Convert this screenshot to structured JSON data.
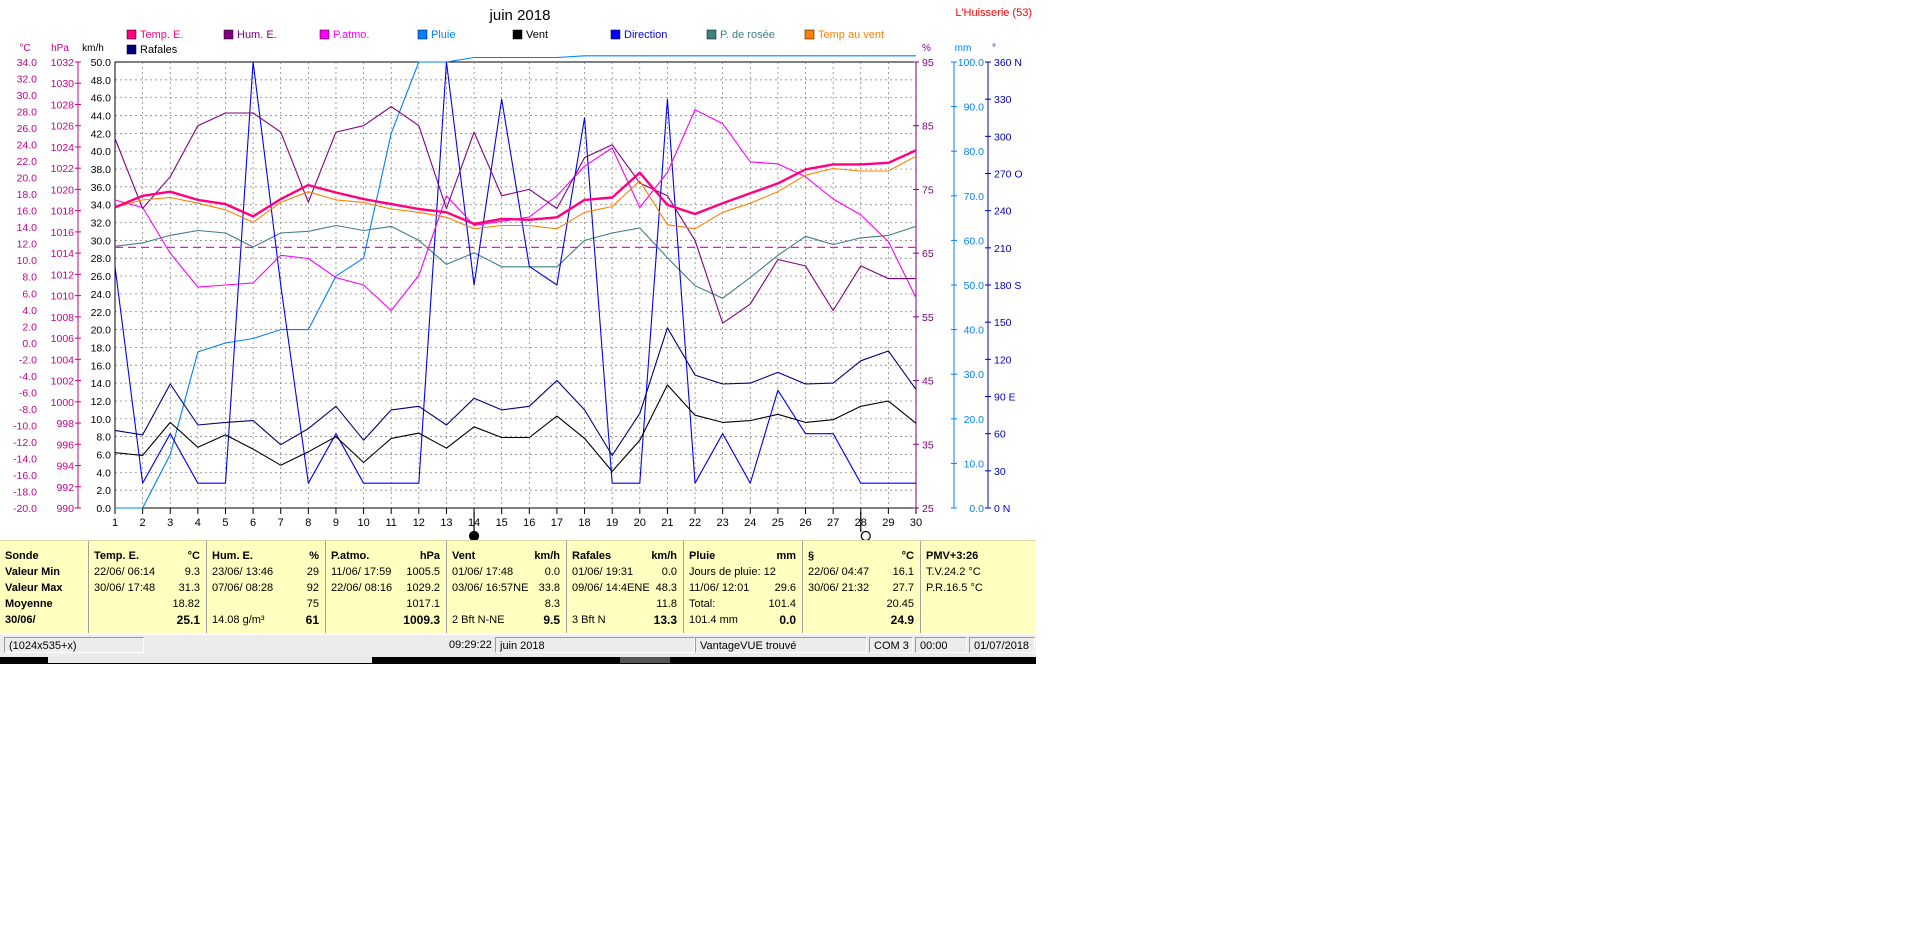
{
  "window": {
    "station": "L'Huisserie (53)"
  },
  "chart_data": {
    "type": "line",
    "title": "juin 2018",
    "x": [
      1,
      2,
      3,
      4,
      5,
      6,
      7,
      8,
      9,
      10,
      11,
      12,
      13,
      14,
      15,
      16,
      17,
      18,
      19,
      20,
      21,
      22,
      23,
      24,
      25,
      26,
      27,
      28,
      29,
      30
    ],
    "axes": [
      {
        "id": "temp",
        "unit": "°C",
        "min": -20,
        "max": 34,
        "ticks": [
          "34.0",
          "32.0",
          "30.0",
          "28.0",
          "26.0",
          "24.0",
          "22.0",
          "20.0",
          "18.0",
          "16.0",
          "14.0",
          "12.0",
          "10.0",
          "8.0",
          "6.0",
          "4.0",
          "2.0",
          "0.0",
          "-2.0",
          "-4.0",
          "-6.0",
          "-8.0",
          "-10.0",
          "-12.0",
          "-14.0",
          "-16.0",
          "-18.0",
          "-20.0"
        ],
        "color": "#cc0088"
      },
      {
        "id": "press",
        "unit": "hPa",
        "min": 990,
        "max": 1032,
        "ticks": [
          "1032",
          "1030",
          "1028",
          "1026",
          "1024",
          "1022",
          "1020",
          "1018",
          "1016",
          "1014",
          "1012",
          "1010",
          "1008",
          "1006",
          "1004",
          "1002",
          "1000",
          "998",
          "996",
          "994",
          "992",
          "990"
        ],
        "color": "#cc0088"
      },
      {
        "id": "speed",
        "unit": "km/h",
        "min": 0,
        "max": 50,
        "ticks": [
          "50.0",
          "48.0",
          "46.0",
          "44.0",
          "42.0",
          "40.0",
          "38.0",
          "36.0",
          "34.0",
          "32.0",
          "30.0",
          "28.0",
          "26.0",
          "24.0",
          "22.0",
          "20.0",
          "18.0",
          "16.0",
          "14.0",
          "12.0",
          "10.0",
          "8.0",
          "6.0",
          "4.0",
          "2.0",
          "0.0"
        ],
        "color": "#000000"
      },
      {
        "id": "hum",
        "unit": "%",
        "min": 25,
        "max": 95,
        "ticks": [
          "95",
          "85",
          "75",
          "65",
          "55",
          "45",
          "35",
          "25"
        ],
        "color": "#800080"
      },
      {
        "id": "rain",
        "unit": "mm",
        "min": 0,
        "max": 100,
        "ticks": [
          "100.0",
          "90.0",
          "80.0",
          "70.0",
          "60.0",
          "50.0",
          "40.0",
          "30.0",
          "20.0",
          "10.0",
          "0.0"
        ],
        "color": "#0080ff"
      },
      {
        "id": "dir",
        "unit": "°",
        "min": 0,
        "max": 360,
        "ticks": [
          "360 N",
          "330",
          "300",
          "270 O",
          "240",
          "210",
          "180 S",
          "150",
          "120",
          "90  E",
          "60",
          "30",
          "0   N"
        ],
        "color": "#0000c0"
      }
    ],
    "series": [
      {
        "name": "Temp. E.",
        "color": "#ff0080",
        "axis": "temp",
        "width": 2.4,
        "values": [
          16.4,
          17.8,
          18.3,
          17.3,
          16.8,
          15.3,
          17.4,
          19.1,
          18.2,
          17.4,
          16.8,
          16.2,
          15.8,
          14.4,
          15.0,
          14.9,
          15.2,
          17.3,
          17.6,
          20.6,
          16.7,
          15.6,
          16.9,
          18.1,
          19.3,
          21.0,
          21.6,
          21.6,
          21.8,
          23.3
        ]
      },
      {
        "name": "Hum. E.",
        "color": "#800080",
        "axis": "hum",
        "values": [
          83,
          72,
          77,
          85,
          87,
          87,
          84,
          73,
          84,
          85,
          88,
          85,
          72,
          84,
          74,
          75,
          72,
          80,
          82,
          76,
          74,
          67,
          54,
          57,
          64,
          63,
          56,
          63,
          61,
          61
        ]
      },
      {
        "name": "P.atmo.",
        "color": "#ff00ff",
        "axis": "press",
        "values": [
          1019.0,
          1018.3,
          1014.0,
          1010.8,
          1011.0,
          1011.2,
          1013.8,
          1013.5,
          1011.7,
          1011.0,
          1008.6,
          1011.9,
          1019.4,
          1016.6,
          1017.0,
          1017.4,
          1019.4,
          1022.2,
          1023.9,
          1018.3,
          1021.6,
          1027.5,
          1026.2,
          1022.6,
          1022.4,
          1021.2,
          1019.1,
          1017.6,
          1015.1,
          1009.8
        ]
      },
      {
        "name": "Pluie",
        "color": "#0080ff",
        "axis": "rain",
        "values": [
          0.0,
          0.0,
          12.0,
          35.0,
          37.0,
          38.0,
          40.0,
          40.0,
          52.0,
          56.0,
          84.0,
          100.0,
          100.0,
          101.0,
          101.0,
          101.0,
          101.0,
          101.4,
          101.4,
          101.4,
          101.4,
          101.4,
          101.4,
          101.4,
          101.4,
          101.4,
          101.4,
          101.4,
          101.4,
          101.4
        ]
      },
      {
        "name": "Vent",
        "color": "#000000",
        "axis": "speed",
        "values": [
          6.2,
          5.9,
          9.6,
          6.8,
          8.2,
          6.6,
          4.8,
          6.3,
          8.0,
          5.1,
          7.8,
          8.4,
          6.7,
          9.1,
          7.9,
          7.9,
          10.3,
          7.8,
          4.1,
          7.6,
          13.8,
          10.4,
          9.6,
          9.8,
          10.5,
          9.6,
          9.9,
          11.4,
          12.0,
          9.5
        ]
      },
      {
        "name": "Direction",
        "color": "#0000ff",
        "axis": "dir",
        "values": [
          195,
          20,
          60,
          20,
          20,
          360,
          180,
          20,
          60,
          20,
          20,
          20,
          360,
          180,
          330,
          195,
          180,
          315,
          20,
          20,
          330,
          20,
          60,
          20,
          95,
          60,
          60,
          20,
          20,
          20
        ]
      },
      {
        "name": "P. de rosée",
        "color": "#408080",
        "axis": "temp",
        "values": [
          11.7,
          12.1,
          13.0,
          13.6,
          13.3,
          11.6,
          13.3,
          13.5,
          14.2,
          13.6,
          14.1,
          12.4,
          9.5,
          10.9,
          9.2,
          9.2,
          9.2,
          12.4,
          13.3,
          13.9,
          10.3,
          6.9,
          5.4,
          7.9,
          10.6,
          12.9,
          11.9,
          12.7,
          13.0,
          14.1
        ]
      },
      {
        "name": "Temp au vent",
        "color": "#ff8000",
        "axis": "temp",
        "values": [
          16.4,
          17.3,
          17.6,
          16.9,
          16.1,
          14.6,
          17.0,
          18.3,
          17.3,
          17.0,
          16.2,
          15.8,
          15.2,
          13.8,
          14.2,
          14.2,
          13.8,
          15.8,
          16.5,
          19.6,
          14.3,
          13.8,
          15.8,
          16.9,
          18.3,
          20.3,
          21.1,
          20.8,
          20.8,
          22.6
        ]
      },
      {
        "name": "Rafales",
        "color": "#000080",
        "axis": "speed",
        "values": [
          8.7,
          8.2,
          13.9,
          9.3,
          9.6,
          9.8,
          7.1,
          8.9,
          11.4,
          7.6,
          11.0,
          11.4,
          9.3,
          12.3,
          11.0,
          11.4,
          14.3,
          11.0,
          5.9,
          10.6,
          20.2,
          14.9,
          13.9,
          14.0,
          15.2,
          13.9,
          14.0,
          16.5,
          17.6,
          13.3
        ]
      }
    ],
    "reference_line": {
      "axis": "hum",
      "value": 65.9,
      "color": "#ff00ff"
    },
    "moon_markers": [
      {
        "x": 14,
        "phase": "new"
      },
      {
        "x": 28,
        "phase": "full"
      }
    ],
    "grid": true
  },
  "stats": {
    "labels": {
      "title": "Sonde",
      "min": "Valeur Min",
      "max": "Valeur Max",
      "avg": "Moyenne",
      "day": "30/06/"
    },
    "temp": {
      "title": "Temp. E.",
      "unit": "°C",
      "min_time": "22/06/  06:14",
      "min": "9.3",
      "max_time": "30/06/  17:48",
      "max": "31.3",
      "avg": "18.82",
      "cur": "25.1"
    },
    "hum": {
      "title": "Hum. E.",
      "unit": "%",
      "min_time": "23/06/  13:46",
      "min": "29",
      "max_time": "07/06/  08:28",
      "max": "92",
      "avg": "75",
      "cur_extra": "14.08 g/m³",
      "cur": "61"
    },
    "press": {
      "title": "P.atmo.",
      "unit": "hPa",
      "min_time": "11/06/  17:59",
      "min": "1005.5",
      "max_time": "22/06/  08:16",
      "max": "1029.2",
      "avg": "1017.1",
      "cur": "1009.3"
    },
    "wind": {
      "title": "Vent",
      "unit": "km/h",
      "min_time": "01/06/  17:48",
      "min": "0.0",
      "max_time": "03/06/  16:57NE",
      "max": "33.8",
      "avg": "8.3",
      "cur_extra": "2 Bft N-NE",
      "cur": "9.5"
    },
    "gust": {
      "title": "Rafales",
      "unit": "km/h",
      "min_time": "01/06/  19:31",
      "min": "0.0",
      "max_time": "09/06/  14:4ENE",
      "max": "48.3",
      "avg": "11.8",
      "cur_extra": "3 Bft N",
      "cur": "13.3"
    },
    "rain": {
      "title": "Pluie",
      "unit": "mm",
      "min_text": "Jours de pluie: 12",
      "max_time": "11/06/  12:01",
      "max": "29.6",
      "avg_label": "Total:",
      "avg": "101.4",
      "cur_extra": "101.4 mm",
      "cur": "0.0"
    },
    "dew": {
      "title": "§",
      "unit": "°C",
      "min_time": "22/06/  04:47",
      "min": "16.1",
      "max_time": "30/06/  21:32",
      "max": "27.7",
      "avg": "20.45",
      "cur": "24.9"
    },
    "pmv": {
      "title": "PMV+3:26",
      "line1": "T.V.24.2 °C",
      "line2": "P.R.16.5 °C"
    }
  },
  "statusbar": {
    "res": "(1024x535+x)",
    "time": "09:29:22",
    "month": "juin 2018",
    "device": "VantageVUE trouvé",
    "port": "COM 3",
    "hour": "00:00",
    "date": "01/07/2018"
  }
}
